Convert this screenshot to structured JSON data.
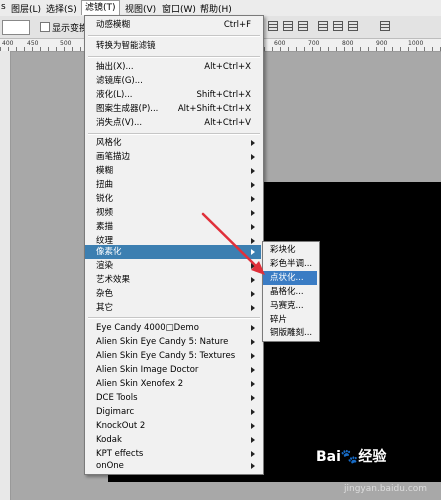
{
  "menubar": {
    "items": [
      "图层(L)",
      "选择(S)",
      "滤镜(T)",
      "视图(V)",
      "窗口(W)",
      "帮助(H)"
    ],
    "prefix": "s"
  },
  "toolbar": {
    "show_label": "显示变换"
  },
  "ruler": {
    "left_ticks": [
      "400",
      "450",
      "500"
    ],
    "right_ticks": [
      "600",
      "700",
      "800",
      "900",
      "1000"
    ]
  },
  "filter_menu": {
    "top_items": [
      {
        "label": "动感模糊",
        "shortcut": "Ctrl+F"
      },
      {
        "label": "转换为智能滤镜",
        "shortcut": ""
      },
      {
        "label": "抽出(X)...",
        "shortcut": "Alt+Ctrl+X"
      },
      {
        "label": "滤镜库(G)...",
        "shortcut": ""
      },
      {
        "label": "液化(L)...",
        "shortcut": "Shift+Ctrl+X"
      },
      {
        "label": "图案生成器(P)...",
        "shortcut": "Alt+Shift+Ctrl+X"
      },
      {
        "label": "消失点(V)...",
        "shortcut": "Alt+Ctrl+V"
      }
    ],
    "categories": [
      "风格化",
      "画笔描边",
      "模糊",
      "扭曲",
      "锐化",
      "视频",
      "素描",
      "纹理",
      "像素化",
      "渲染",
      "艺术效果",
      "杂色",
      "其它"
    ],
    "plugins": [
      "Eye Candy 4000□Demo",
      "Alien Skin Eye Candy 5: Nature",
      "Alien Skin Eye Candy 5: Textures",
      "Alien Skin Image Doctor",
      "Alien Skin Xenofex 2",
      "DCE Tools",
      "Digimarc",
      "KnockOut 2",
      "Kodak",
      "KPT effects",
      "onOne"
    ]
  },
  "pixelate_menu": {
    "items": [
      "彩块化",
      "彩色半调...",
      "点状化...",
      "晶格化...",
      "马赛克...",
      "碎片",
      "铜版雕刻..."
    ]
  },
  "watermark": {
    "text": "Bai🐾经验",
    "sub": "jingyan.baidu.com"
  },
  "colors": {
    "highlight": "#3c7fb1",
    "arrow": "#e0303a"
  }
}
